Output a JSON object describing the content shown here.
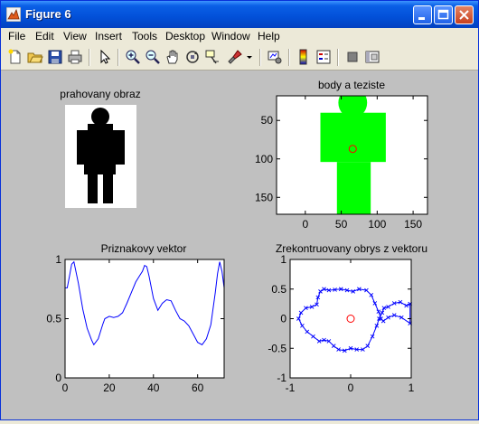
{
  "window": {
    "title": "Figure 6",
    "title_icon": "matlab-figure-icon",
    "controls": [
      "minimize-icon",
      "maximize-icon",
      "close-icon"
    ]
  },
  "menu": {
    "items": [
      {
        "label": "File"
      },
      {
        "label": "Edit"
      },
      {
        "label": "View"
      },
      {
        "label": "Insert"
      },
      {
        "label": "Tools"
      },
      {
        "label": "Desktop"
      },
      {
        "label": "Window"
      },
      {
        "label": "Help"
      }
    ]
  },
  "toolbar": {
    "icons": [
      "new-figure-icon",
      "open-file-icon",
      "save-icon",
      "print-icon",
      "edit-plot-arrow-icon",
      "zoom-in-icon",
      "zoom-out-icon",
      "pan-hand-icon",
      "rotate-3d-icon",
      "data-cursor-icon",
      "brush-icon",
      "brush-dropdown-icon",
      "link-plot-icon",
      "colorbar-icon",
      "legend-icon",
      "hide-plot-tools-icon",
      "show-plot-tools-icon"
    ]
  },
  "colors": {
    "figure_bg": "#c0c0c0",
    "silhouette": "#000000",
    "body_fill": "#00ff00",
    "centroid": "#ff0000",
    "curve": "#0000ff"
  },
  "chart_data": [
    {
      "type": "image",
      "title": "prahovany obraz",
      "axes_visible": false,
      "description_values": {
        "foreground": "black",
        "background": "white"
      }
    },
    {
      "type": "scatter",
      "title": "body a teziste",
      "xlim": [
        -40,
        170
      ],
      "ylim": [
        172,
        18
      ],
      "y_reversed": true,
      "xticks": [
        0,
        50,
        100,
        150
      ],
      "yticks": [
        50,
        100,
        150
      ],
      "region_color": "#00ff00",
      "body_regions": [
        {
          "shape": "rect",
          "x": [
            44,
            91
          ],
          "y": [
            172,
            104
          ]
        },
        {
          "shape": "rect",
          "x": [
            21,
            112
          ],
          "y": [
            104,
            40
          ]
        },
        {
          "shape": "circle",
          "cx": 66,
          "cy": 27,
          "r": 20
        }
      ],
      "centroid": {
        "x": 66,
        "y": 87
      }
    },
    {
      "type": "line",
      "title": "Priznakovy vektor",
      "xlim": [
        0,
        72
      ],
      "ylim": [
        0,
        1
      ],
      "xticks": [
        0,
        20,
        40,
        60
      ],
      "yticks": [
        0,
        0.5,
        1
      ],
      "series": [
        {
          "x": [
            0,
            1,
            2,
            3,
            4,
            6,
            8,
            10,
            12,
            13,
            15,
            17,
            18,
            20,
            22,
            24,
            26,
            28,
            30,
            32,
            34,
            35,
            36,
            37,
            38,
            40,
            42,
            44,
            46,
            48,
            50,
            52,
            54,
            56,
            58,
            60,
            62,
            64,
            66,
            68,
            69,
            70,
            71,
            72
          ],
          "y": [
            0.76,
            0.76,
            0.86,
            0.96,
            0.98,
            0.8,
            0.58,
            0.42,
            0.32,
            0.28,
            0.33,
            0.45,
            0.5,
            0.52,
            0.51,
            0.52,
            0.55,
            0.63,
            0.72,
            0.81,
            0.87,
            0.9,
            0.95,
            0.94,
            0.86,
            0.67,
            0.57,
            0.63,
            0.66,
            0.65,
            0.57,
            0.5,
            0.48,
            0.44,
            0.37,
            0.3,
            0.28,
            0.33,
            0.45,
            0.72,
            0.88,
            0.98,
            0.9,
            0.76
          ]
        }
      ]
    },
    {
      "type": "line",
      "title": "Zrekontruovany obrys z vektoru",
      "xlim": [
        -1,
        1
      ],
      "ylim": [
        -1,
        1
      ],
      "xticks": [
        -1,
        0,
        1
      ],
      "yticks": [
        -1,
        -0.5,
        0,
        0.5,
        1
      ],
      "marker": "x",
      "series": [
        {
          "x": [
            0.98,
            0.92,
            0.82,
            0.72,
            0.62,
            0.55,
            0.52,
            0.47,
            0.43,
            0.36,
            0.28,
            0.2,
            0.1,
            0.0,
            -0.1,
            -0.2,
            -0.28,
            -0.36,
            -0.44,
            -0.52,
            -0.62,
            -0.72,
            -0.8,
            -0.86,
            -0.82,
            -0.74,
            -0.64,
            -0.56,
            -0.54,
            -0.5,
            -0.44,
            -0.36,
            -0.26,
            -0.16,
            -0.06,
            0.04,
            0.14,
            0.26,
            0.34,
            0.4,
            0.46,
            0.5,
            0.54,
            0.62,
            0.72,
            0.84,
            0.98
          ],
          "y": [
            0.25,
            0.22,
            0.28,
            0.26,
            0.2,
            0.18,
            0.1,
            0.0,
            -0.12,
            -0.3,
            -0.46,
            -0.52,
            -0.52,
            -0.5,
            -0.54,
            -0.52,
            -0.46,
            -0.38,
            -0.36,
            -0.38,
            -0.3,
            -0.22,
            -0.12,
            0.0,
            0.1,
            0.18,
            0.2,
            0.24,
            0.36,
            0.46,
            0.5,
            0.48,
            0.49,
            0.5,
            0.48,
            0.46,
            0.5,
            0.48,
            0.4,
            0.26,
            0.12,
            0.0,
            -0.04,
            0.02,
            0.06,
            0.02,
            -0.08
          ]
        }
      ],
      "centroid": {
        "x": 0,
        "y": 0
      }
    }
  ]
}
